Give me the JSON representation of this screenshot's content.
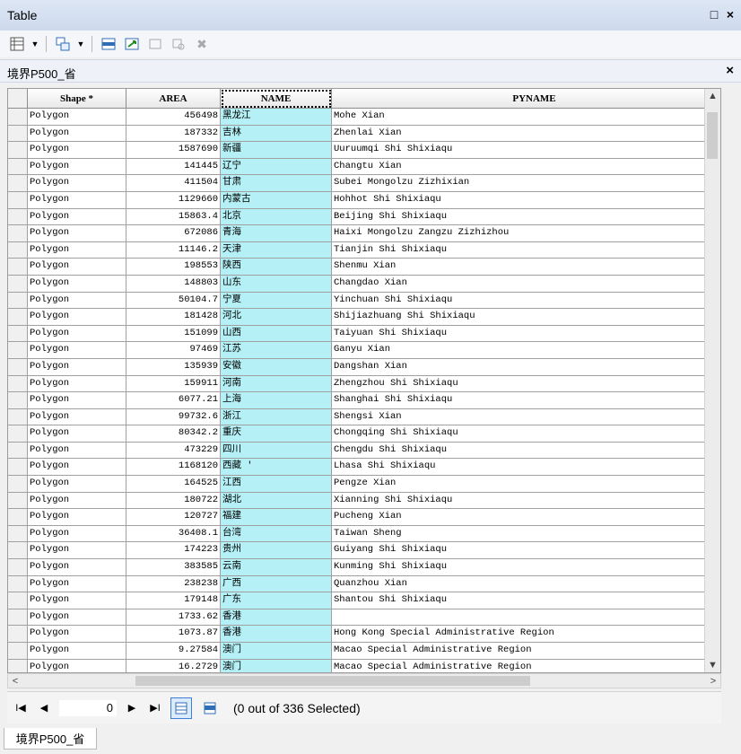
{
  "window": {
    "title": "Table",
    "maximize_label": "□",
    "close_label": "×"
  },
  "toolbar": {
    "icons": [
      "table-options-icon",
      "dropdown-icon",
      "related-tables-icon",
      "dropdown-icon",
      "select-by-attributes-icon",
      "switch-selection-icon",
      "clear-selection-icon",
      "zoom-to-selected-icon",
      "delete-selected-icon"
    ]
  },
  "table_tab": {
    "name": "境界P500_省",
    "close_label": "×"
  },
  "columns": [
    "Shape *",
    "AREA",
    "NAME",
    "PYNAME"
  ],
  "rows": [
    [
      "Polygon",
      "456498",
      "黑龙江",
      "Mohe Xian"
    ],
    [
      "Polygon",
      "187332",
      "吉林",
      "Zhenlai Xian"
    ],
    [
      "Polygon",
      "1587690",
      "新疆",
      "Uuruumqi Shi Shixiaqu"
    ],
    [
      "Polygon",
      "141445",
      "辽宁",
      "Changtu Xian"
    ],
    [
      "Polygon",
      "411504",
      "甘肃",
      "Subei Mongolzu Zizhixian"
    ],
    [
      "Polygon",
      "1129660",
      "内蒙古",
      "Hohhot Shi Shixiaqu"
    ],
    [
      "Polygon",
      "15863.4",
      "北京",
      "Beijing Shi Shixiaqu"
    ],
    [
      "Polygon",
      "672086",
      "青海",
      "Haixi Mongolzu Zangzu Zizhizhou"
    ],
    [
      "Polygon",
      "11146.2",
      "天津",
      "Tianjin Shi Shixiaqu"
    ],
    [
      "Polygon",
      "198553",
      "陕西",
      "Shenmu Xian"
    ],
    [
      "Polygon",
      "148803",
      "山东",
      "Changdao Xian"
    ],
    [
      "Polygon",
      "50104.7",
      "宁夏",
      "Yinchuan Shi Shixiaqu"
    ],
    [
      "Polygon",
      "181428",
      "河北",
      "Shijiazhuang Shi Shixiaqu"
    ],
    [
      "Polygon",
      "151099",
      "山西",
      "Taiyuan Shi Shixiaqu"
    ],
    [
      "Polygon",
      "97469",
      "江苏",
      "Ganyu Xian"
    ],
    [
      "Polygon",
      "135939",
      "安徽",
      "Dangshan Xian"
    ],
    [
      "Polygon",
      "159911",
      "河南",
      "Zhengzhou Shi Shixiaqu"
    ],
    [
      "Polygon",
      "6077.21",
      "上海",
      "Shanghai Shi Shixiaqu"
    ],
    [
      "Polygon",
      "99732.6",
      "浙江",
      "Shengsi Xian"
    ],
    [
      "Polygon",
      "80342.2",
      "重庆",
      "Chongqing Shi Shixiaqu"
    ],
    [
      "Polygon",
      "473229",
      "四川",
      "Chengdu Shi Shixiaqu"
    ],
    [
      "Polygon",
      "1168120",
      "西藏 '",
      "Lhasa Shi Shixiaqu"
    ],
    [
      "Polygon",
      "164525",
      "江西",
      "Pengze Xian"
    ],
    [
      "Polygon",
      "180722",
      "湖北",
      "Xianning Shi Shixiaqu"
    ],
    [
      "Polygon",
      "120727",
      "福建",
      "Pucheng Xian"
    ],
    [
      "Polygon",
      "36408.1",
      "台湾",
      "Taiwan Sheng"
    ],
    [
      "Polygon",
      "174223",
      "贵州",
      "Guiyang Shi Shixiaqu"
    ],
    [
      "Polygon",
      "383585",
      "云南",
      "Kunming Shi Shixiaqu"
    ],
    [
      "Polygon",
      "238238",
      "广西",
      "Quanzhou Xian"
    ],
    [
      "Polygon",
      "179148",
      "广东",
      "Shantou Shi Shixiaqu"
    ],
    [
      "Polygon",
      "1733.62",
      "香港",
      ""
    ],
    [
      "Polygon",
      "1073.87",
      "香港",
      "Hong Kong Special Administrative Region"
    ],
    [
      "Polygon",
      "9.27584",
      "澳门",
      "Macao Special Administrative Region"
    ],
    [
      "Polygon",
      "16.2729",
      "澳门",
      "Macao Special Administrative Region"
    ]
  ],
  "scroll": {
    "up": "▲",
    "down": "▼",
    "left": "<",
    "right": ">"
  },
  "navigation": {
    "first": "I◀",
    "prev": "◀",
    "record": "0",
    "next": "▶",
    "last": "▶I",
    "status": "(0 out of 336 Selected)"
  },
  "bottom_tab": {
    "name": "境界P500_省"
  }
}
